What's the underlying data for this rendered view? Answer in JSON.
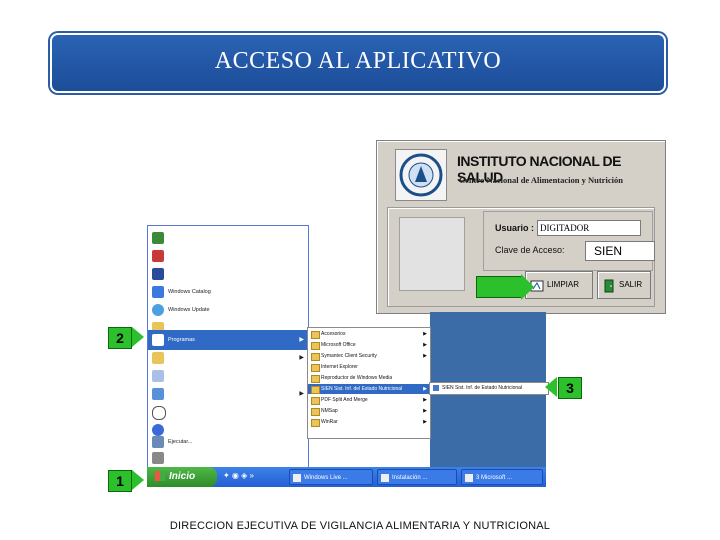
{
  "slide": {
    "title": "ACCESO AL APLICATIVO",
    "footer": "DIRECCION EJECUTIVA DE VIGILANCIA ALIMENTARIA Y NUTRICIONAL"
  },
  "login_window": {
    "institution": "INSTITUTO NACIONAL DE SALUD",
    "subtitle": "Centro Nacional de Alimentacion y Nutrición",
    "user_label": "Usuario :",
    "user_value": "DIGITADOR",
    "password_label": "Clave de Acceso:",
    "password_value": "SIEN",
    "clear_label": "LIMPIAR",
    "exit_label": "SALIR"
  },
  "start_menu": {
    "start_label": "Inicio",
    "items": [
      "",
      "",
      "",
      "Windows Catalog",
      "Windows Update",
      "",
      "Programas",
      "",
      "",
      "",
      "",
      "",
      "Ejecutar...",
      ""
    ],
    "programs": [
      "Accesorios",
      "Microsoft Office",
      "Symantec Client Security",
      "Internet Explorer",
      "Reproductor de Windows Media",
      "SIEN Sist. Inf. del Estado Nutricional",
      "PDF Split And Merge",
      "NMSap",
      "WinRar"
    ],
    "sien_item": "SIEN Sist. Inf. de Estado Nutricional"
  },
  "taskbar": {
    "tasks": [
      "Windows Live ...",
      "Instalación ...",
      "3 Microsoft ..."
    ]
  },
  "callouts": [
    "1",
    "2",
    "3"
  ],
  "colors": {
    "banner": "#1c4d99",
    "callout": "#2cc02c",
    "selection": "#316ac5"
  }
}
